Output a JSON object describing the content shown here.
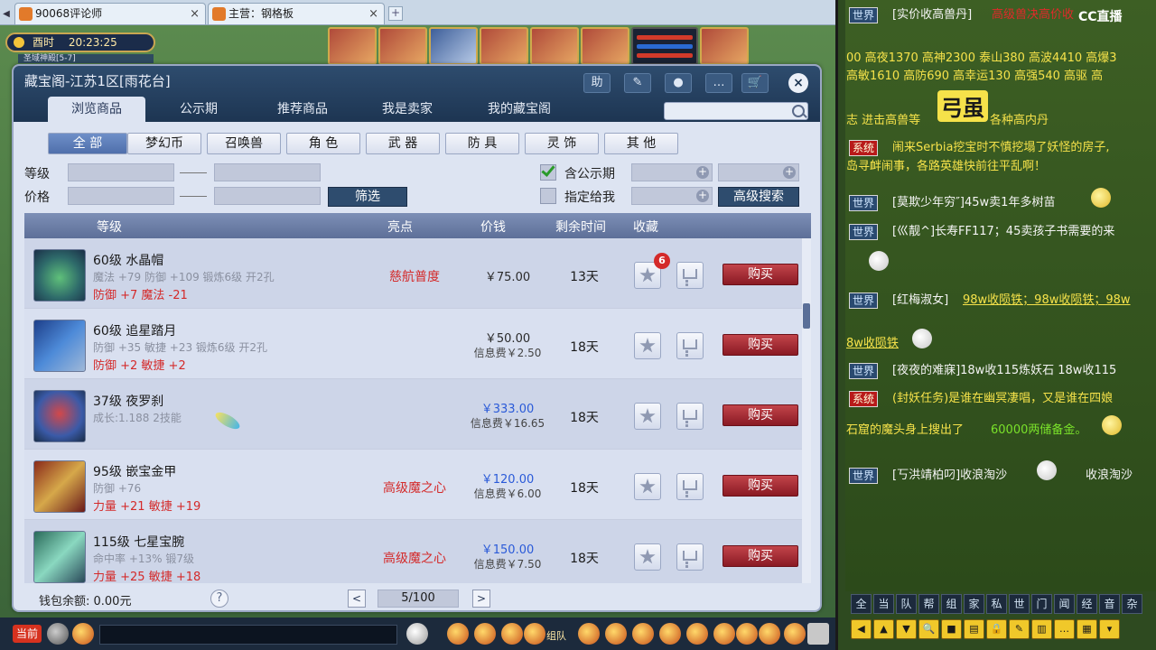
{
  "browser_tabs": [
    {
      "label": "90068评论师",
      "close": "×"
    },
    {
      "label": "主营：钢格板",
      "close": "×"
    }
  ],
  "new_tab_label": "+",
  "scroll_left_label": "◀",
  "clock": {
    "period": "酉时",
    "time": "20:23:25"
  },
  "location": "圣域神殿[5-7]",
  "dialog": {
    "title": "藏宝阁-江苏1区[雨花台]",
    "header_buttons": {
      "help": "助",
      "hammer": "✎",
      "record": "●",
      "chat": "…",
      "cart": "🛒",
      "close": "×"
    },
    "tabs": [
      "浏览商品",
      "公示期",
      "推荐商品",
      "我是卖家",
      "我的藏宝阁"
    ],
    "active_tab": 0,
    "search_placeholder": "",
    "categories": [
      "全 部",
      "梦幻币",
      "召唤兽",
      "角 色",
      "武 器",
      "防 具",
      "灵 饰",
      "其 他"
    ],
    "active_category": 0,
    "filters": {
      "level_label": "等级",
      "price_label": "价格",
      "filter_button": "筛选",
      "public_period_label": "含公示期",
      "public_period_checked": true,
      "assigned_label": "指定给我",
      "assigned_checked": false,
      "plus": "+",
      "advanced_search": "高级搜索"
    },
    "table_headers": {
      "level": "等级",
      "highlight": "亮点",
      "price": "价钱",
      "time": "剩余时间",
      "fav": "收藏"
    },
    "items": [
      {
        "name": "60级  水晶帽",
        "stats": "魔法 +79 防御 +109 锻炼6级 开2孔",
        "bonus": "防御 +7 魔法 -21",
        "highlight": "慈航普度",
        "price": "￥75.00",
        "fee": "",
        "time": "13天",
        "fav_count": "6",
        "buy": "购买",
        "icon": "helmet-icon"
      },
      {
        "name": "60级  追星踏月",
        "stats": "防御 +35 敏捷 +23 锻炼6级 开2孔",
        "bonus": "防御 +2 敏捷 +2",
        "highlight": "",
        "price": "￥50.00",
        "fee": "信息费￥2.50",
        "time": "18天",
        "fav_count": "",
        "buy": "购买",
        "icon": "boots-icon"
      },
      {
        "name": "37级  夜罗刹",
        "stats": "成长:1.188 2技能",
        "bonus": "",
        "highlight": "",
        "price": "￥333.00",
        "fee": "信息费￥16.65",
        "time": "18天",
        "fav_count": "",
        "buy": "购买",
        "icon": "pet-icon"
      },
      {
        "name": "95级  嵌宝金甲",
        "stats": "防御 +76",
        "bonus": "力量 +21 敏捷 +19",
        "highlight": "高级魔之心",
        "price": "￥120.00",
        "fee": "信息费￥6.00",
        "time": "18天",
        "fav_count": "",
        "buy": "购买",
        "icon": "armor-icon"
      },
      {
        "name": "115级  七星宝腕",
        "stats": "命中率 +13% 锻7级",
        "bonus": "力量 +25 敏捷 +18",
        "highlight": "高级魔之心",
        "price": "￥150.00",
        "fee": "信息费￥7.50",
        "time": "18天",
        "fav_count": "",
        "buy": "购买",
        "icon": "bracer-icon"
      }
    ],
    "footer": {
      "wallet": "钱包余额: 0.00元",
      "help": "?",
      "prev": "<",
      "page": "5/100",
      "next": ">"
    }
  },
  "bottom_bar": {
    "channel": "当前",
    "team": "组队"
  },
  "chat": {
    "logo": "CC直播",
    "big_glyph": "弓虽",
    "lines": [
      {
        "tag": "世界",
        "text": "[实价收高兽丹]",
        "tail": "高级兽决高价收"
      },
      {
        "tag": "",
        "text": "00 高夜1370 高神2300 泰山380 高波4410 高爆3"
      },
      {
        "tag": "",
        "text": "高敏1610 高防690 高幸运130 高强540 高驱 高"
      },
      {
        "tag": "",
        "text": "志 进击高兽等",
        "tail": "各种高内丹"
      },
      {
        "tag": "系统",
        "text": "闹来Serbia挖宝时不慎挖塌了妖怪的房子,"
      },
      {
        "tag": "",
        "text": "岛寻衅闹事，各路英雄快前往平乱啊！"
      },
      {
        "tag": "世界",
        "text": "[莫欺少年穷″]45w卖1年多树苗"
      },
      {
        "tag": "世界",
        "text": "[巛靓^]长寿FF117；45卖孩子书需要的来"
      },
      {
        "tag": "世界",
        "text": "[红梅淑女]",
        "tail": "98w收陨铁；98w收陨铁；98w"
      },
      {
        "tag": "",
        "text": "8w收陨铁"
      },
      {
        "tag": "世界",
        "text": "[夜夜的难寐]18w收115炼妖石    18w收115"
      },
      {
        "tag": "系统",
        "text": "(封妖任务)是谁在幽冥凄唱，又是谁在四娘"
      },
      {
        "tag": "",
        "text": "石窟的魔头身上搜出了",
        "tail": "60000两储备金。"
      },
      {
        "tag": "世界",
        "text": "[丂洪靖柏叼]收浪淘沙",
        "tail": "收浪淘沙"
      }
    ],
    "channels": [
      "全",
      "当",
      "队",
      "帮",
      "组",
      "家",
      "私",
      "世",
      "门",
      "闻",
      "经",
      "音",
      "杂"
    ],
    "tools": [
      "◀",
      "▲",
      "▼",
      "🔍",
      "■",
      "▤",
      "🔒",
      "✎",
      "▥",
      "…",
      "▦",
      "▾"
    ]
  },
  "colors": {
    "header": "#2e4c6e",
    "buy": "#a8303a",
    "price_blue": "#2a5ad8",
    "bonus_red": "#d42a2a"
  }
}
